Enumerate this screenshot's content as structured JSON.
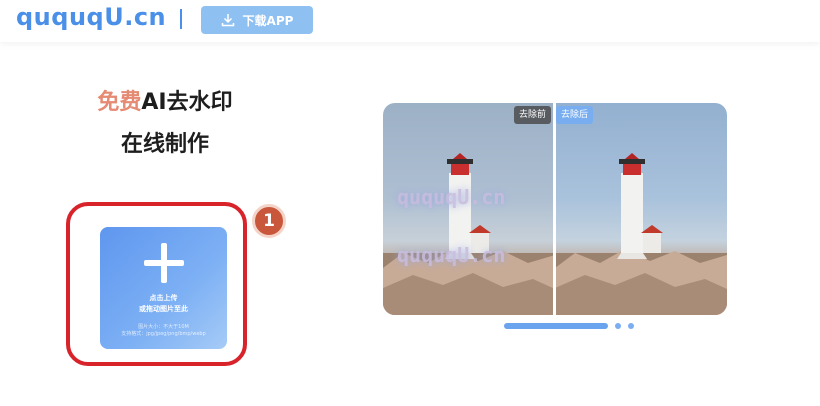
{
  "header": {
    "logo": "ququqU.cn",
    "download_label": "下载APP",
    "download_icon": "download-icon"
  },
  "hero": {
    "line1_accent": "免费",
    "line1_rest": "AI去水印",
    "line2": "在线制作"
  },
  "upload": {
    "step_number": "1",
    "main_line1": "点击上传",
    "main_line2": "或拖动图片至此",
    "note_line1": "图片大小：不大于10M",
    "note_line2": "支持格式：jpg/jpeg/png/bmp/webp"
  },
  "comparison": {
    "before_label": "去除前",
    "after_label": "去除后",
    "watermark_text": "ququqU.cn"
  },
  "colors": {
    "brand": "#4a8fe8",
    "accent": "#e58a73",
    "highlight_frame": "#d8232a"
  },
  "carousel": {
    "active_index": 1,
    "count": 3
  }
}
